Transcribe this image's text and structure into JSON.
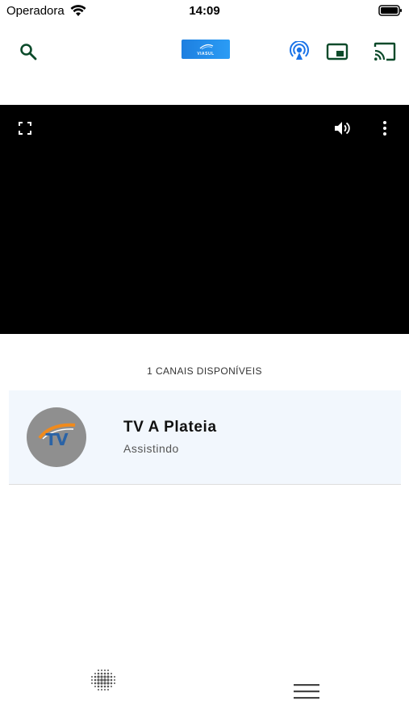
{
  "status_bar": {
    "carrier": "Operadora",
    "time": "14:09"
  },
  "toolbar": {
    "icons": {
      "search": "search-icon",
      "podcast": "podcast-icon",
      "pip": "picture-in-picture-icon",
      "cast": "cast-icon"
    },
    "accent_color": "#0b6a3a",
    "cast_accent_color": "#1a73e8"
  },
  "brand": {
    "logo_text": "VIASUL"
  },
  "player": {
    "background_color": "#000000"
  },
  "channels": {
    "heading": "1 CANAIS DISPONÍVEIS",
    "items": [
      {
        "title": "TV A Plateia",
        "subtitle": "Assistindo",
        "logo_text": "TV"
      }
    ]
  }
}
